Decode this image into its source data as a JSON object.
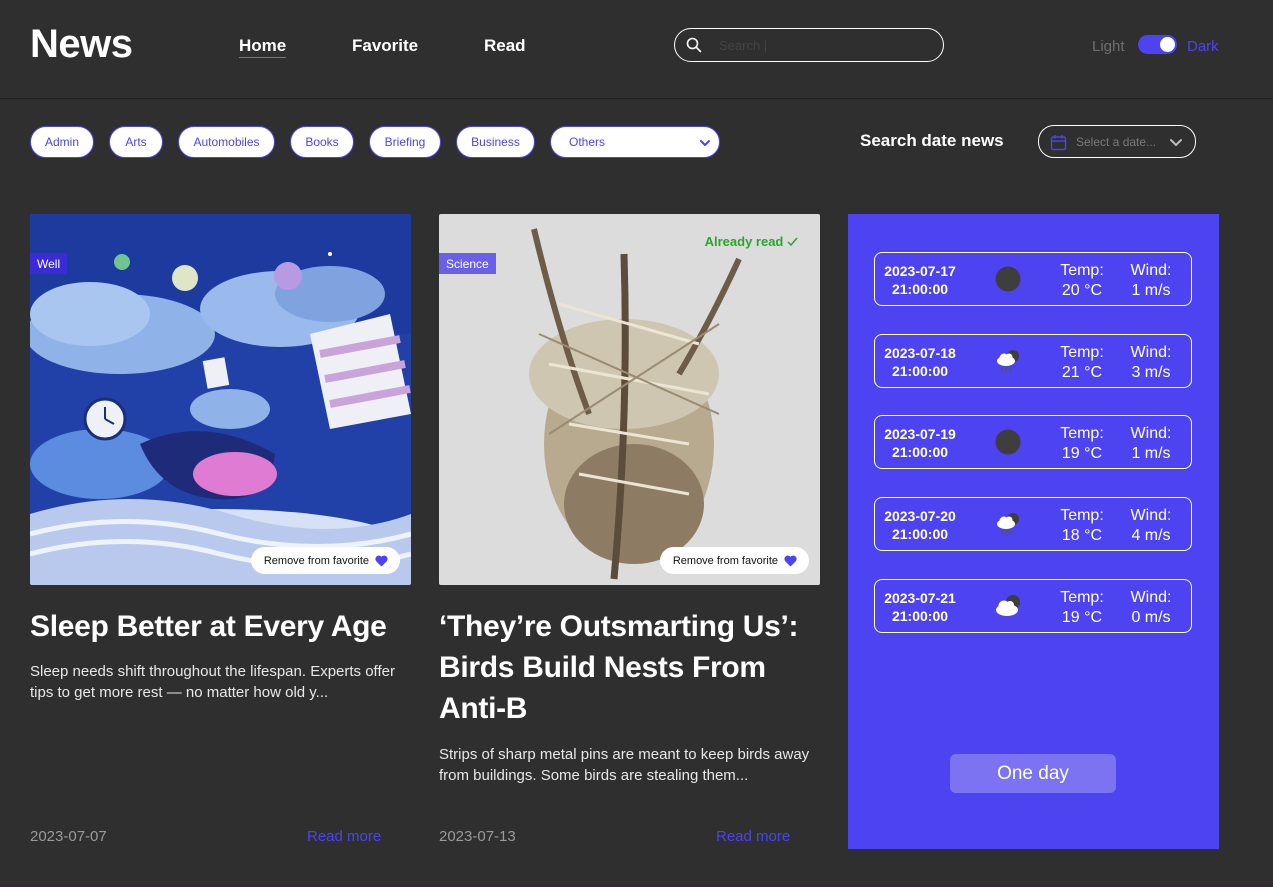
{
  "header": {
    "logo": "News",
    "nav": [
      {
        "label": "Home",
        "active": true
      },
      {
        "label": "Favorite",
        "active": false
      },
      {
        "label": "Read",
        "active": false
      }
    ],
    "search": {
      "placeholder": "Search |",
      "value": ""
    },
    "theme": {
      "light_label": "Light",
      "dark_label": "Dark",
      "mode": "dark"
    }
  },
  "filters": {
    "categories": [
      "Admin",
      "Arts",
      "Automobiles",
      "Books",
      "Briefing",
      "Business"
    ],
    "others_label": "Others",
    "date_title": "Search date news",
    "date_placeholder": "Select a date..."
  },
  "cards": [
    {
      "category": "Well",
      "already_read": "",
      "favorite_label": "Remove from favorite",
      "title": "Sleep Better at Every Age",
      "description": "Sleep needs shift throughout the lifespan. Experts offer tips to get more rest — no matter how old y...",
      "date": "2023-07-07",
      "read_more": "Read more"
    },
    {
      "category": "Science",
      "already_read": "Already read",
      "favorite_label": "Remove from favorite",
      "title": "‘They’re Outsmarting Us’: Birds Build Nests From Anti-B",
      "description": "Strips of sharp metal pins are meant to keep birds away from buildings. Some birds are stealing them...",
      "date": "2023-07-13",
      "read_more": "Read more"
    }
  ],
  "weather": {
    "rows": [
      {
        "date": "2023-07-17",
        "time": "21:00:00",
        "icon": "moon-icon",
        "temp_label": "Temp:",
        "temp": "20 °C",
        "wind_label": "Wind:",
        "wind": "1 m/s"
      },
      {
        "date": "2023-07-18",
        "time": "21:00:00",
        "icon": "rain-cloud-moon-icon",
        "temp_label": "Temp:",
        "temp": "21 °C",
        "wind_label": "Wind:",
        "wind": "3 m/s"
      },
      {
        "date": "2023-07-19",
        "time": "21:00:00",
        "icon": "moon-icon",
        "temp_label": "Temp:",
        "temp": "19 °C",
        "wind_label": "Wind:",
        "wind": "1 m/s"
      },
      {
        "date": "2023-07-20",
        "time": "21:00:00",
        "icon": "rain-cloud-moon-icon",
        "temp_label": "Temp:",
        "temp": "18 °C",
        "wind_label": "Wind:",
        "wind": "4 m/s"
      },
      {
        "date": "2023-07-21",
        "time": "21:00:00",
        "icon": "cloud-moon-icon",
        "temp_label": "Temp:",
        "temp": "19 °C",
        "wind_label": "Wind:",
        "wind": "0 m/s"
      }
    ],
    "button_label": "One day"
  },
  "colors": {
    "accent": "#4d43f0",
    "background": "#2f2f2f",
    "read_green": "#2ba52b"
  }
}
